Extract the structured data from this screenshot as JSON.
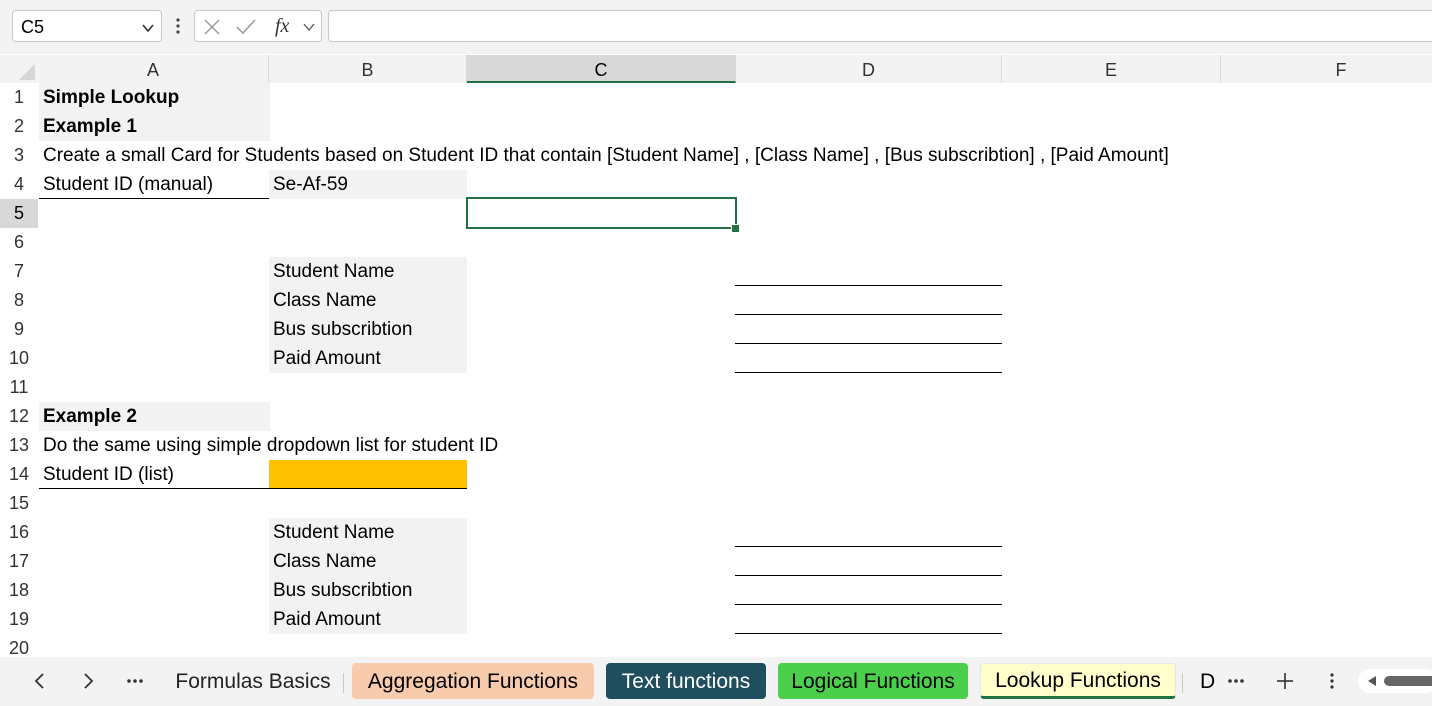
{
  "formula_bar": {
    "name_box": "C5",
    "formula": ""
  },
  "columns": [
    "A",
    "B",
    "C",
    "D",
    "E",
    "F"
  ],
  "selected_column": "C",
  "rows": [
    "1",
    "2",
    "3",
    "4",
    "5",
    "6",
    "7",
    "8",
    "9",
    "10",
    "11",
    "12",
    "13",
    "14",
    "15",
    "16",
    "17",
    "18",
    "19",
    "20"
  ],
  "selected_row": "5",
  "cells": {
    "A1": "Simple Lookup",
    "A2": "Example 1",
    "A3": "Create a small Card for Students based on Student ID that contain [Student Name] , [Class Name] , [Bus subscribtion] , [Paid Amount]",
    "A4": "Student ID (manual)",
    "B4": "Se-Af-59",
    "B7": "Student Name",
    "B8": "Class Name",
    "B9": "Bus subscribtion",
    "B10": "Paid Amount",
    "A12": "Example 2",
    "A13": "Do the same using simple dropdown list for student ID",
    "A14": "Student ID (list)",
    "B16": "Student Name",
    "B17": "Class Name",
    "B18": "Bus subscribtion",
    "B19": "Paid Amount"
  },
  "colors": {
    "accent": "#217346",
    "dropdown_fill": "#ffc000",
    "label_fill": "#f2f2f2"
  },
  "sheet_tabs": [
    {
      "label": "Formulas Basics",
      "color": "#f3f3f3",
      "text_color": "#222222"
    },
    {
      "label": "Aggregation Functions",
      "color": "#f8cbad",
      "text_color": "#000000"
    },
    {
      "label": "Text functions",
      "color": "#1f4e5f",
      "text_color": "#ffffff"
    },
    {
      "label": "Logical Functions",
      "color": "#4cd04c",
      "text_color": "#000000"
    },
    {
      "label": "Lookup Functions",
      "color": "#ffffcc",
      "text_color": "#000000",
      "active": true
    },
    {
      "label": "D",
      "color": "#f3f3f3",
      "text_color": "#000000"
    }
  ]
}
